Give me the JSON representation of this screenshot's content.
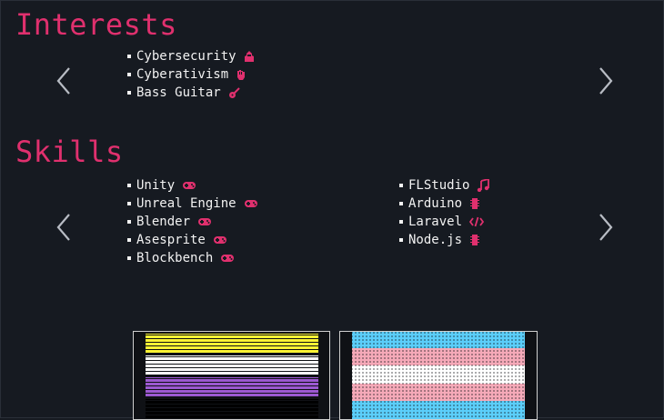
{
  "interests": {
    "title": "Interests",
    "items": [
      {
        "label": "Cybersecurity",
        "icon": "hacker-icon"
      },
      {
        "label": "Cyberativism",
        "icon": "fist-icon"
      },
      {
        "label": "Bass Guitar",
        "icon": "guitar-icon"
      }
    ]
  },
  "skills": {
    "title": "Skills",
    "left": [
      {
        "label": "Unity",
        "icon": "gamepad-icon"
      },
      {
        "label": "Unreal Engine",
        "icon": "gamepad-icon"
      },
      {
        "label": "Blender",
        "icon": "gamepad-icon"
      },
      {
        "label": "Asesprite",
        "icon": "gamepad-icon"
      },
      {
        "label": "Blockbench",
        "icon": "gamepad-icon"
      }
    ],
    "right": [
      {
        "label": "FLStudio",
        "icon": "music-note-icon"
      },
      {
        "label": "Arduino",
        "icon": "chip-icon"
      },
      {
        "label": "Laravel",
        "icon": "code-icon"
      },
      {
        "label": "Node.js",
        "icon": "chip-icon"
      }
    ]
  },
  "flags": [
    {
      "name": "nonbinary-flag",
      "colors": [
        "#fcf434",
        "#ffffff",
        "#9c59d1",
        "#000000"
      ]
    },
    {
      "name": "transgender-flag",
      "colors": [
        "#5bcefa",
        "#f5a9b8",
        "#ffffff",
        "#f5a9b8",
        "#5bcefa"
      ]
    }
  ],
  "colors": {
    "accent": "#e0306e",
    "background": "#161a21",
    "text": "#f2f2f2",
    "arrow": "#b8bcc4"
  }
}
